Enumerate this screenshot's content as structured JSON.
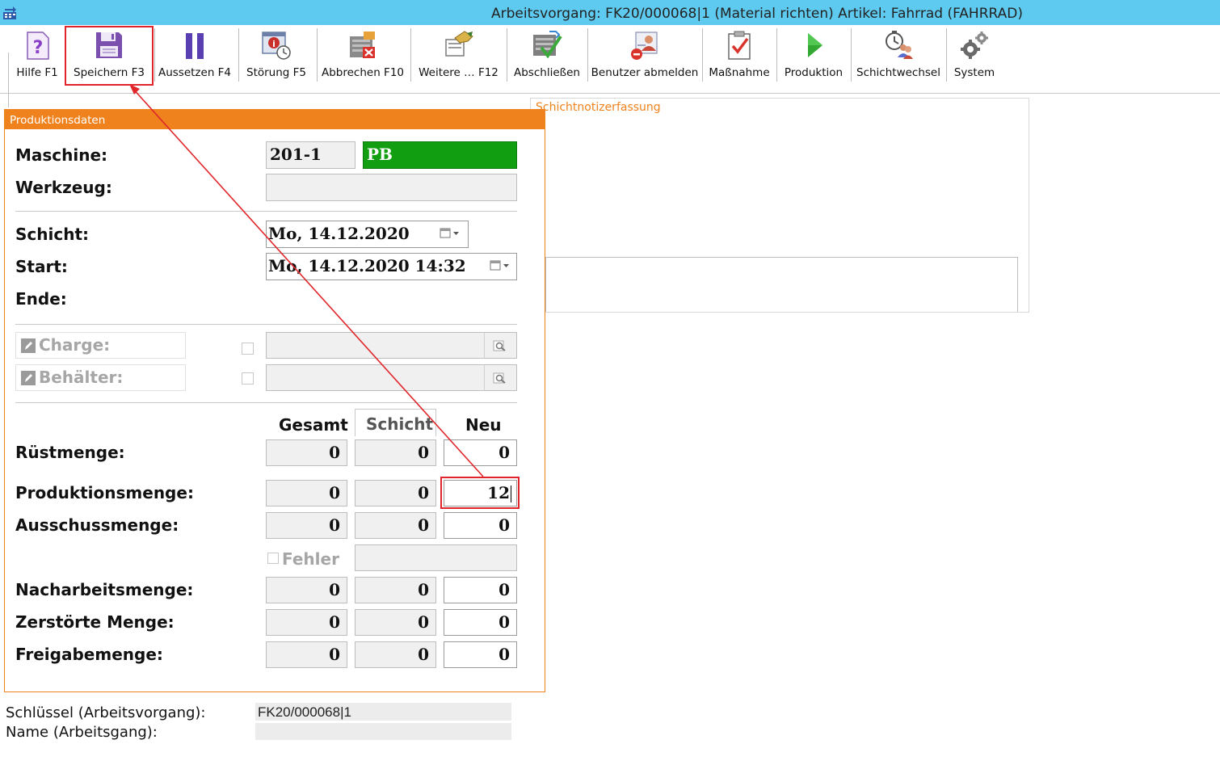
{
  "window": {
    "title": "Arbeitsvorgang: FK20/000068|1 (Material richten)  Artikel: Fahrrad (FAHRRAD)"
  },
  "toolbar": {
    "help": "Hilfe F1",
    "save": "Speichern F3",
    "pause": "Aussetzen F4",
    "fault": "Störung F5",
    "cancel": "Abbrechen F10",
    "more": "Weitere … F12",
    "finish": "Abschließen",
    "logout": "Benutzer abmelden",
    "measure": "Maßnahme",
    "production": "Produktion",
    "shiftchange": "Schichtwechsel",
    "system": "System"
  },
  "notes": {
    "label": "Schichtnotizerfassung"
  },
  "panel": {
    "header": "Produktionsdaten",
    "machine_label": "Maschine:",
    "machine_value": "201-1",
    "machine_status": "PB",
    "tool_label": "Werkzeug:",
    "tool_value": "",
    "shift_label": "Schicht:",
    "shift_value": "Mo, 14.12.2020",
    "start_label": "Start:",
    "start_value": "Mo, 14.12.2020  14:32",
    "end_label": "Ende:",
    "charge_label": "Charge:",
    "container_label": "Behälter:",
    "col_total": "Gesamt",
    "col_shift": "Schicht",
    "col_new": "Neu",
    "defect_label": "Fehler",
    "rows": [
      {
        "label": "Rüstmenge:",
        "total": "0",
        "shift": "0",
        "new": "0"
      },
      {
        "label": "Produktionsmenge:",
        "total": "0",
        "shift": "0",
        "new": "12"
      },
      {
        "label": "Ausschussmenge:",
        "total": "0",
        "shift": "0",
        "new": "0"
      },
      {
        "label": "Nacharbeitsmenge:",
        "total": "0",
        "shift": "0",
        "new": "0"
      },
      {
        "label": "Zerstörte Menge:",
        "total": "0",
        "shift": "0",
        "new": "0"
      },
      {
        "label": "Freigabemenge:",
        "total": "0",
        "shift": "0",
        "new": "0"
      }
    ]
  },
  "footer": {
    "key_label": "Schlüssel (Arbeitsvorgang):",
    "key_value": "FK20/000068|1",
    "name_label": "Name (Arbeitsgang):",
    "name_value": ""
  },
  "colors": {
    "titlebar": "#5fcaf0",
    "accent": "#f0821e",
    "status_green": "#119e11",
    "highlight": "#e0262a"
  }
}
